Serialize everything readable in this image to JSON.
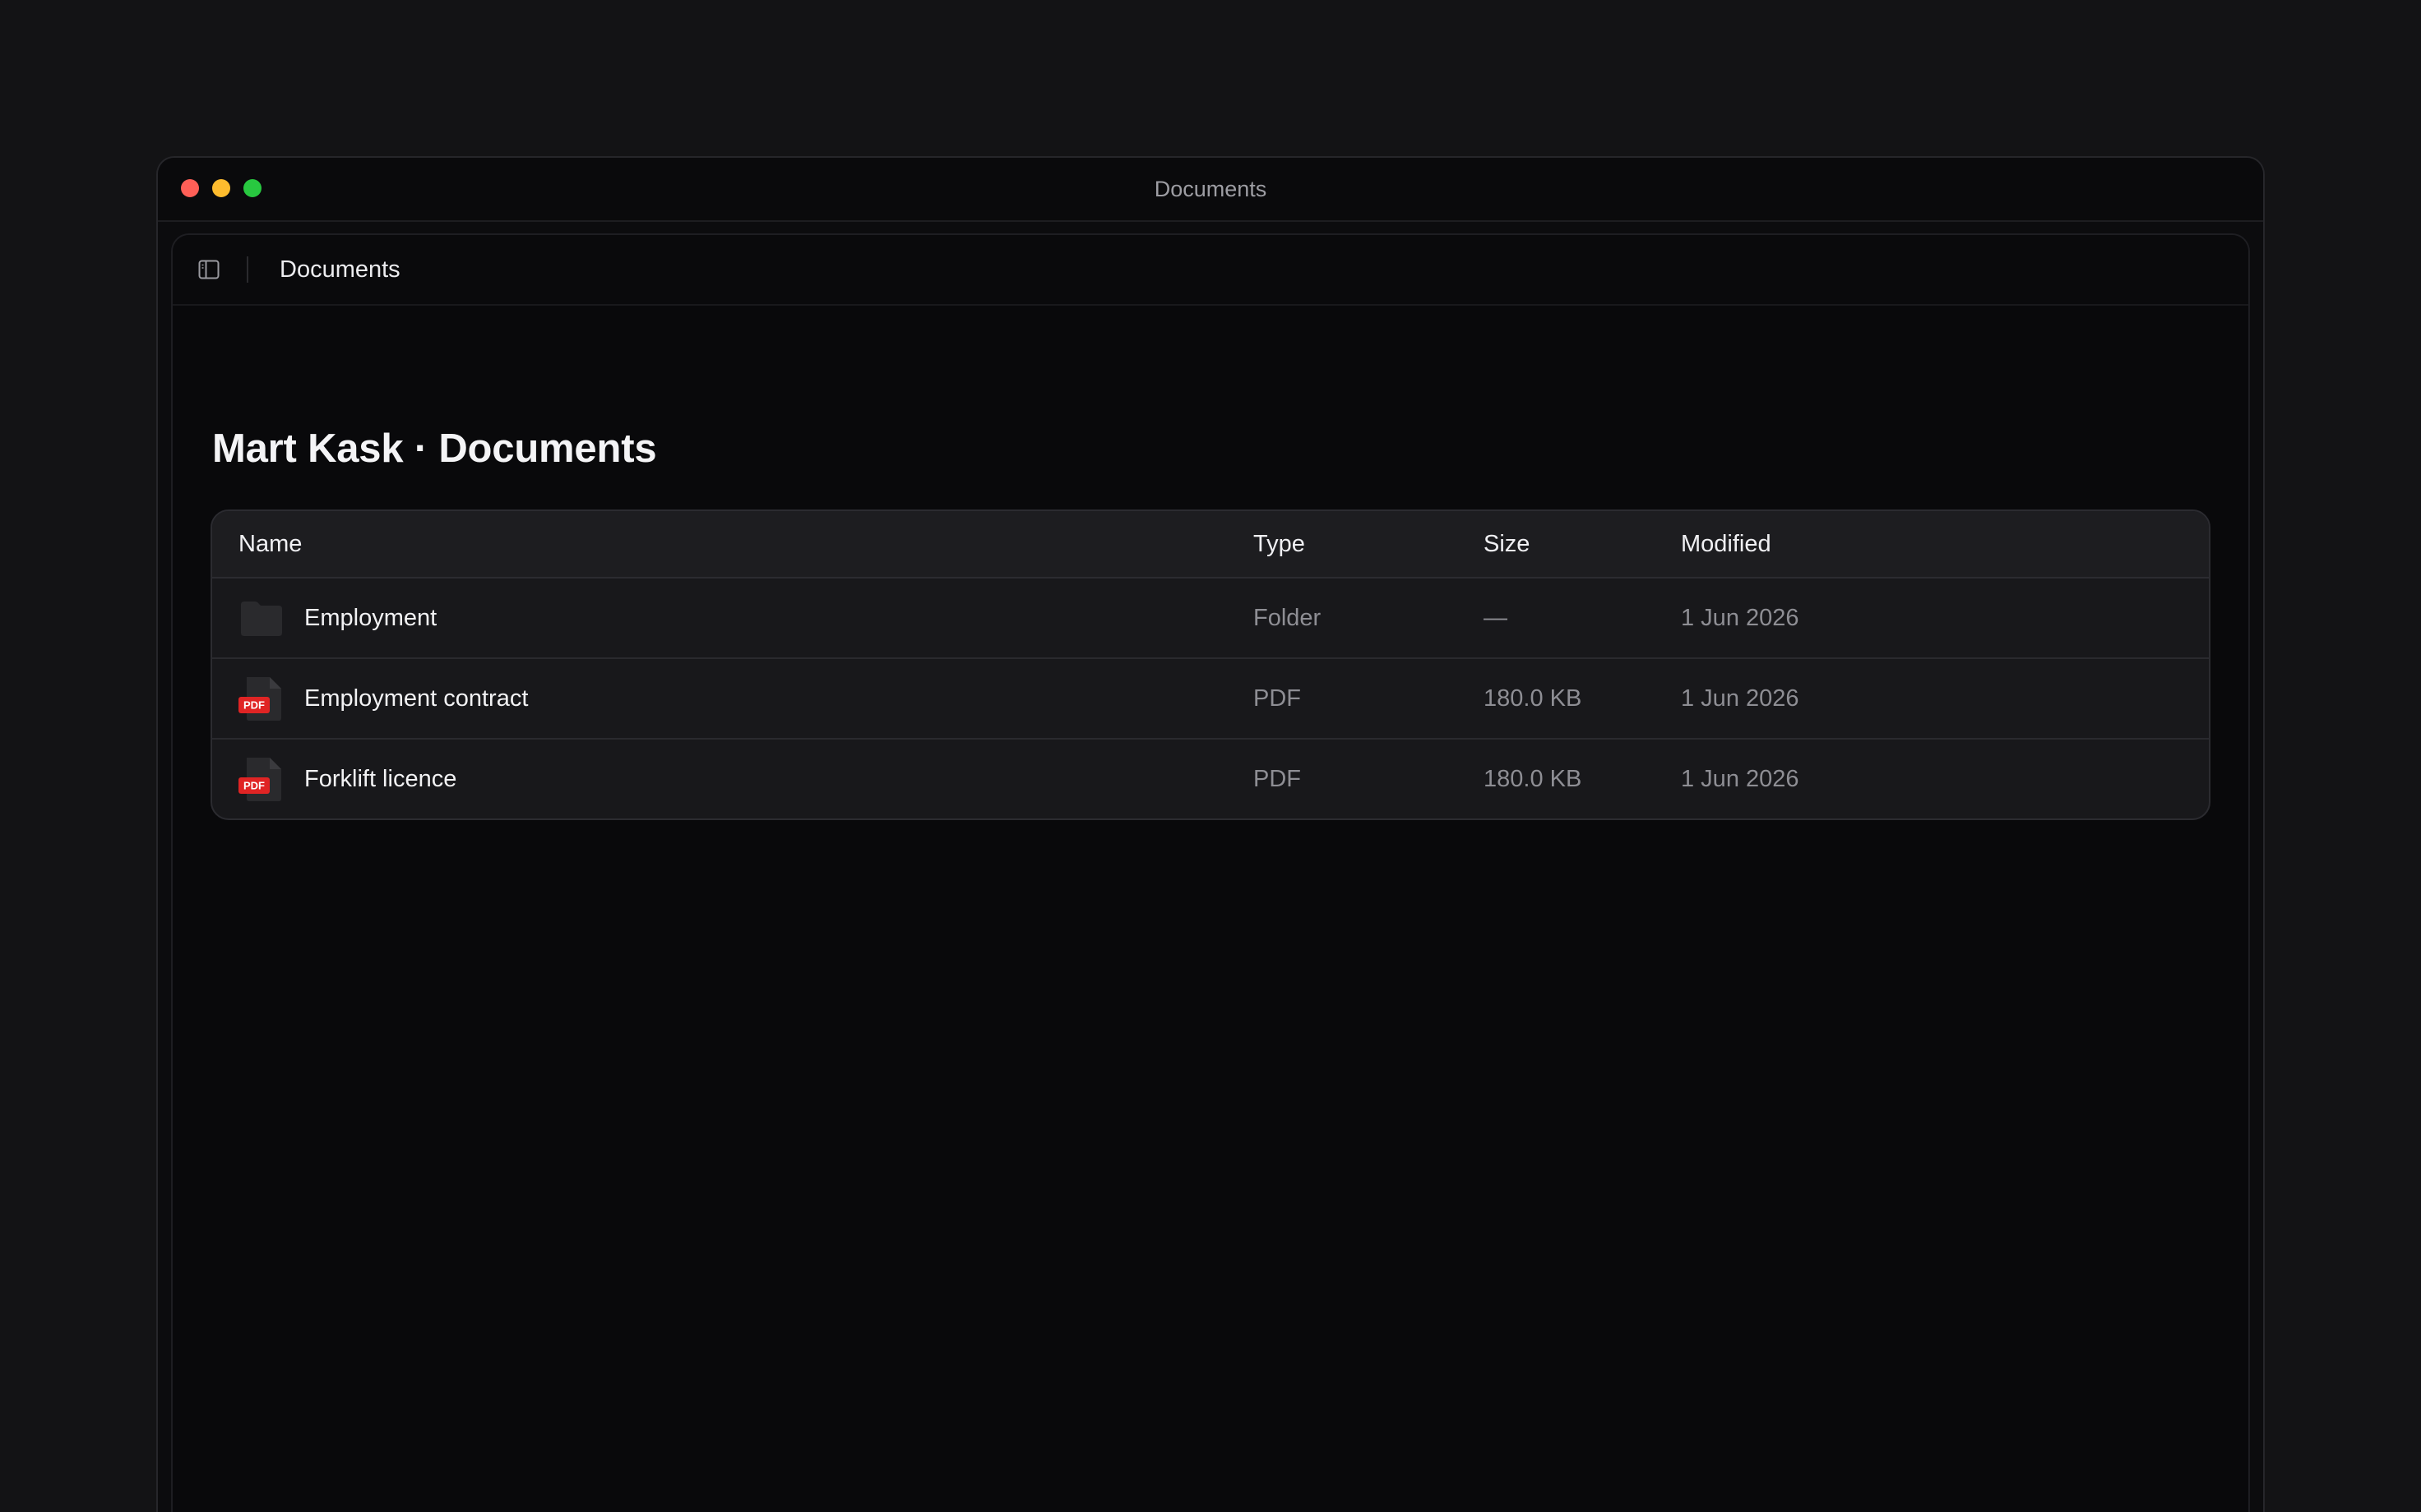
{
  "window": {
    "title": "Documents"
  },
  "topbar": {
    "breadcrumb": "Documents",
    "sidebar_icon": "sidebar-toggle-icon"
  },
  "page": {
    "title": "Mart Kask · Documents"
  },
  "table": {
    "headers": {
      "name": "Name",
      "type": "Type",
      "size": "Size",
      "modified": "Modified"
    },
    "rows": [
      {
        "name": "Employment",
        "type": "Folder",
        "size": "—",
        "modified": "1 Jun 2026",
        "icon": "folder-icon"
      },
      {
        "name": "Employment contract",
        "type": "PDF",
        "size": "180.0 KB",
        "modified": "1 Jun 2026",
        "icon": "pdf-file-icon",
        "badge": "PDF"
      },
      {
        "name": "Forklift licence",
        "type": "PDF",
        "size": "180.0 KB",
        "modified": "1 Jun 2026",
        "icon": "pdf-file-icon",
        "badge": "PDF"
      }
    ]
  },
  "colors": {
    "background": "#131315",
    "panel": "#09090b",
    "table": "#18181b",
    "pdf_badge": "#e02424",
    "traffic_red": "#ff5f57",
    "traffic_yellow": "#febc2e",
    "traffic_green": "#28c840"
  }
}
